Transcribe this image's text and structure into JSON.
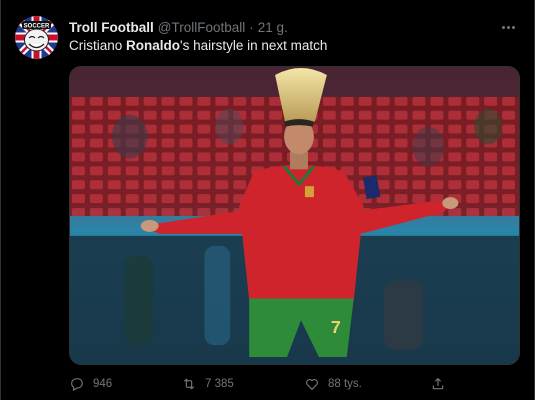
{
  "tweet": {
    "author_name": "Troll Football",
    "author_handle": "@TrollFootball",
    "separator": "·",
    "time": "21 g.",
    "text_before": "Cristiano ",
    "text_bold": "Ronaldo",
    "text_after": "'s hairstyle in next match",
    "avatar_icon": "troll-face-union-jack-icon",
    "avatar_text": "SOCCER",
    "jersey_number": "7"
  },
  "actions": {
    "replies": "946",
    "retweets": "7 385",
    "likes": "88 tys.",
    "reply_icon": "reply-icon",
    "retweet_icon": "retweet-icon",
    "like_icon": "heart-icon",
    "share_icon": "share-icon"
  },
  "colors": {
    "background": "#000000",
    "text_primary": "#e7e9ea",
    "text_secondary": "#71767b",
    "border": "#2f3336"
  }
}
